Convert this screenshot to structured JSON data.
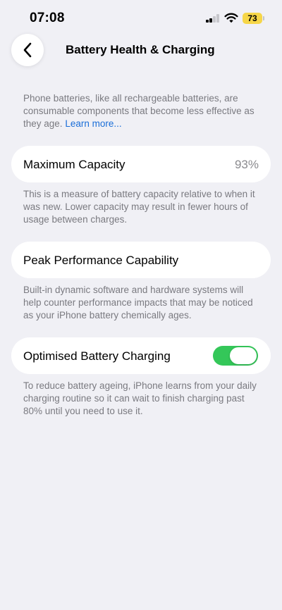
{
  "status_bar": {
    "time": "07:08",
    "battery_level": "73",
    "battery_color": "#f6d648",
    "signal_bars_active": 2,
    "signal_bars_total": 4
  },
  "nav": {
    "title": "Battery Health & Charging",
    "back_icon": "chevron-left-icon"
  },
  "intro": {
    "text": "Phone batteries, like all rechargeable batteries, are consumable components that become less effective as they age.",
    "link": "Learn more..."
  },
  "maximum_capacity": {
    "label": "Maximum Capacity",
    "value": "93%",
    "description": "This is a measure of battery capacity relative to when it was new. Lower capacity may result in fewer hours of usage between charges."
  },
  "peak_performance": {
    "label": "Peak Performance Capability",
    "description": "Built-in dynamic software and hardware systems will help counter performance impacts that may be noticed as your iPhone battery chemically ages."
  },
  "optimised_charging": {
    "label": "Optimised Battery Charging",
    "enabled": true,
    "toggle_color": "#34c759",
    "description": "To reduce battery ageing, iPhone learns from your daily charging routine so it can wait to finish charging past 80% until you need to use it."
  },
  "colors": {
    "background": "#f0f0f5",
    "link": "#1a6ed8",
    "secondary_text": "#7a7a80"
  }
}
